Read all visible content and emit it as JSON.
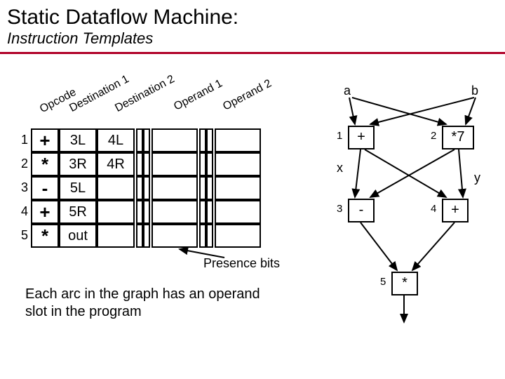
{
  "title": "Static Dataflow Machine:",
  "subtitle": "Instruction Templates",
  "headers": {
    "opcode": "Opcode",
    "dest1": "Destination 1",
    "dest2": "Destination 2",
    "op1": "Operand 1",
    "op2": "Operand 2"
  },
  "rows": [
    {
      "n": "1",
      "op": "+",
      "d1": "3L",
      "d2": "4L"
    },
    {
      "n": "2",
      "op": "*",
      "d1": "3R",
      "d2": "4R"
    },
    {
      "n": "3",
      "op": "-",
      "d1": "5L",
      "d2": ""
    },
    {
      "n": "4",
      "op": "+",
      "d1": "5R",
      "d2": ""
    },
    {
      "n": "5",
      "op": "*",
      "d1": "out",
      "d2": ""
    }
  ],
  "presence_label": "Presence bits",
  "caption": "Each arc in the graph has an operand slot in the program",
  "graph": {
    "inputs": {
      "a": "a",
      "b": "b",
      "x": "x",
      "y": "y"
    },
    "nodes": {
      "n1": {
        "id": "1",
        "op": "+"
      },
      "n2": {
        "id": "2",
        "op": "*7"
      },
      "n3": {
        "id": "3",
        "op": "-"
      },
      "n4": {
        "id": "4",
        "op": "+"
      },
      "n5": {
        "id": "5",
        "op": "*"
      }
    }
  }
}
